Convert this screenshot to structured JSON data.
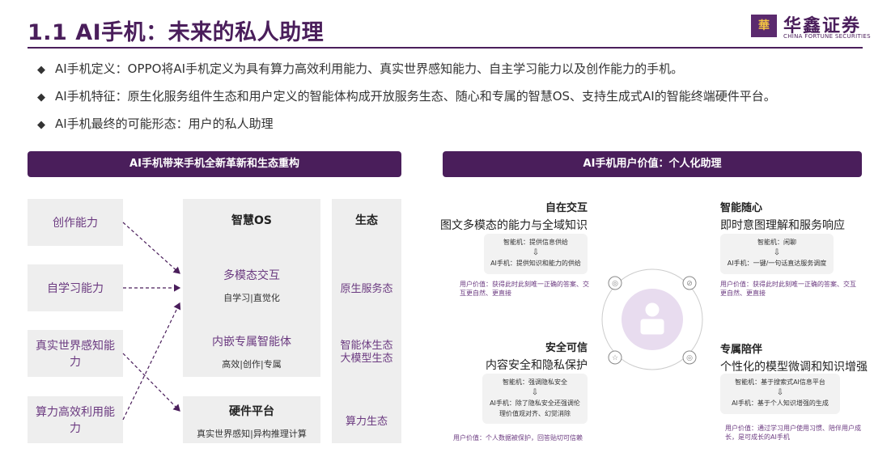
{
  "header": {
    "title": "1.1 AI手机：未来的私人助理",
    "logo_mark": "華",
    "logo_cn": "华鑫证券",
    "logo_en": "CHINA FORTUNE SECURITIES"
  },
  "bullets": [
    "AI手机定义：OPPO将AI手机定义为具有算力高效利用能力、真实世界感知能力、自主学习能力以及创作能力的手机。",
    "AI手机特征：原生化服务组件生态和用户定义的智能体构成开放服务生态、随心和专属的智慧OS、支持生成式AI的智能终端硬件平台。",
    "AI手机最终的可能形态：用户的私人助理"
  ],
  "left": {
    "header": "AI手机带来手机全新革新和生态重构",
    "abilities": [
      "创作能力",
      "自学习能力",
      "真实世界感知能力",
      "算力高效利用能力"
    ],
    "os_title": "智慧OS",
    "os_block1_title": "多模态交互",
    "os_block1_sub": "自学习|直觉化",
    "os_block2_title": "内嵌专属智能体",
    "os_block2_sub": "高效|创作|专属",
    "hw_title": "硬件平台",
    "hw_sub": "真实世界感知|异构推理计算",
    "eco_title": "生态",
    "eco_items": [
      "原生服务态",
      "智能体生态\n大模型生态",
      "算力生态"
    ]
  },
  "right": {
    "header": "AI手机用户价值：个人化助理",
    "q1": {
      "title": "自在交互",
      "subtitle": "图文多模态的能力与全域知识",
      "card_top": "智能机：提供信息供给",
      "card_bottom": "AI手机：提供知识和能力的供给",
      "value": "用户价值：获得此时此刻唯一正确的答案、交互更自然、更直接"
    },
    "q2": {
      "title": "智能随心",
      "subtitle": "即时意图理解和服务响应",
      "card_top": "智能机：闲聊",
      "card_bottom": "AI手机：一键/一句话直达服务调度",
      "value": "用户价值：获得此时此刻唯一正确的答案、交互更自然、更直接"
    },
    "q3": {
      "title": "安全可信",
      "subtitle": "内容安全和隐私保护",
      "card_top": "智能机：强调隐私安全",
      "card_bottom": "AI手机：除了隐私安全还强调伦理价值观对齐、幻觉消除",
      "value": "用户价值：个人数据被保护，回答贴切可信赖"
    },
    "q4": {
      "title": "专属陪伴",
      "subtitle": "个性化的模型微调和知识增强",
      "card_top": "智能机：基于搜索式AI信息平台",
      "card_bottom": "AI手机：基于个人知识增强的生成",
      "value": "用户价值：通过学习用户使用习惯、陪伴用户成长，是可成长的AI手机"
    },
    "arrow_glyph": "⇩",
    "icons": [
      "target-icon",
      "compass-icon",
      "star-icon",
      "shield-check-icon",
      "user-laptop-icon"
    ]
  },
  "colors": {
    "brand": "#4a1e5b",
    "accent": "#6b3a80",
    "box": "#eeeeee"
  }
}
